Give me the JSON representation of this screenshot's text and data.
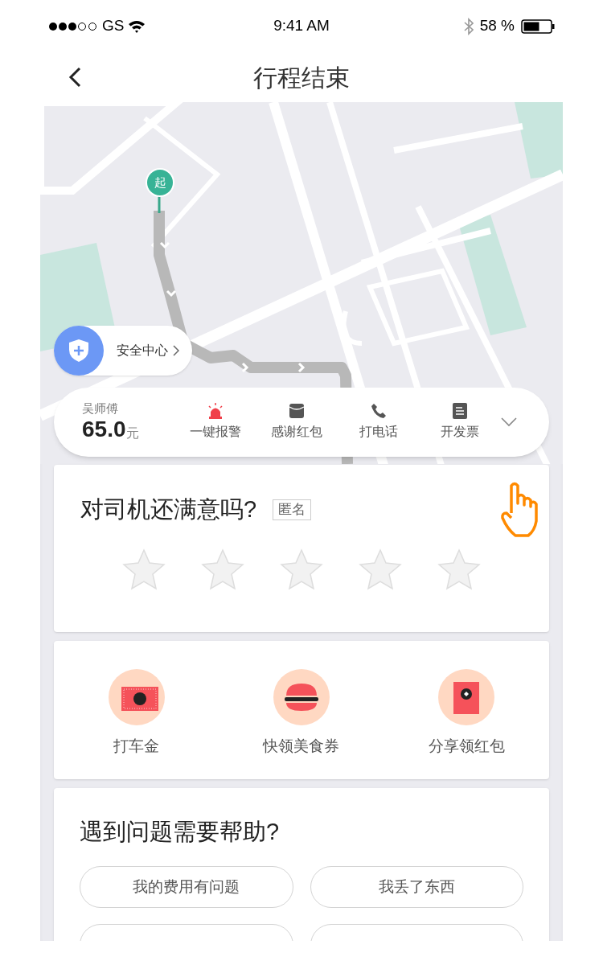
{
  "status_bar": {
    "carrier": "GS",
    "time": "9:41 AM",
    "battery": "58 %"
  },
  "nav": {
    "title": "行程结束"
  },
  "map": {
    "start_marker": "起"
  },
  "safety_center": {
    "label": "安全中心"
  },
  "driver_bar": {
    "driver": "吴师傅",
    "fare": "65.0",
    "currency": "元",
    "actions": [
      {
        "kind": "alarm",
        "label": "一键报警"
      },
      {
        "kind": "envelope",
        "label": "感谢红包"
      },
      {
        "kind": "phone",
        "label": "打电话"
      },
      {
        "kind": "invoice",
        "label": "开发票"
      }
    ]
  },
  "rating": {
    "question": "对司机还满意吗?",
    "tag": "匿名",
    "stars": 0
  },
  "rewards": [
    {
      "kind": "cash",
      "label": "打车金"
    },
    {
      "kind": "burger",
      "label": "快领美食券"
    },
    {
      "kind": "red_packet",
      "label": "分享领红包"
    }
  ],
  "help": {
    "title": "遇到问题需要帮助?",
    "options": [
      "我的费用有问题",
      "我丢了东西"
    ]
  }
}
